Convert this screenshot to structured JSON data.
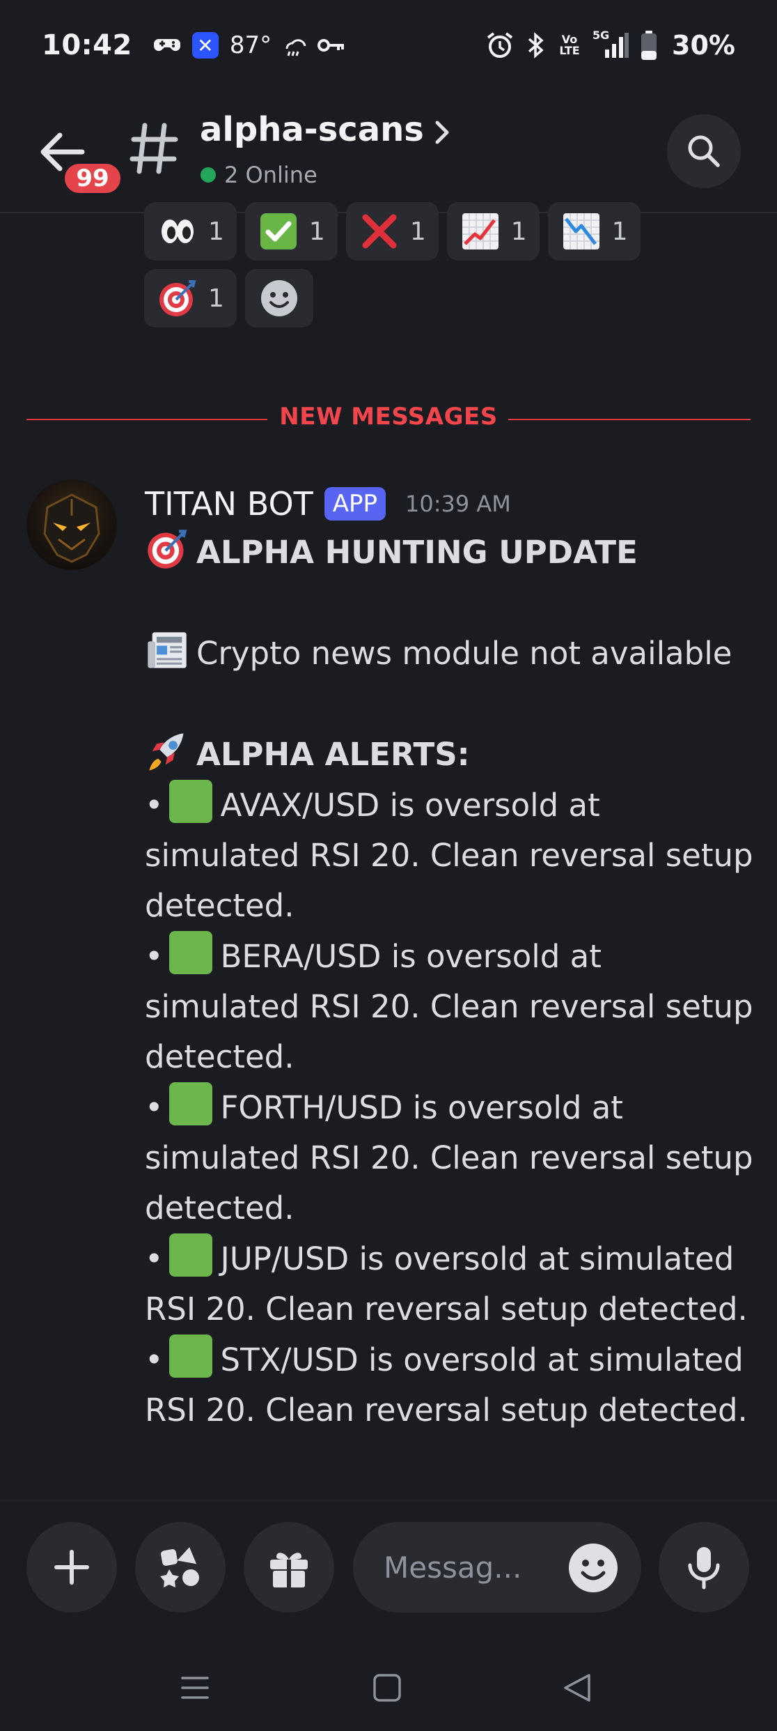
{
  "status_bar": {
    "time": "10:42",
    "temperature": "87°",
    "battery": "30%",
    "icons": [
      "gamepad-icon",
      "app-x-icon",
      "weather-icon",
      "key-icon",
      "alarm-icon",
      "bluetooth-icon",
      "volte-icon",
      "signal-5g-icon",
      "battery-icon"
    ],
    "volte_label": "Vo LTE",
    "network_label": "5G"
  },
  "header": {
    "unread_count": "99",
    "channel_name": "alpha-scans",
    "online_status": "2 Online"
  },
  "reactions": [
    {
      "emoji": "eyes-icon",
      "count": "1"
    },
    {
      "emoji": "check-mark-icon",
      "count": "1"
    },
    {
      "emoji": "cross-mark-icon",
      "count": "1"
    },
    {
      "emoji": "chart-increasing-icon",
      "count": "1"
    },
    {
      "emoji": "chart-decreasing-icon",
      "count": "1"
    },
    {
      "emoji": "direct-hit-icon",
      "count": "1"
    }
  ],
  "divider": {
    "label": "NEW MESSAGES"
  },
  "message": {
    "author": "TITAN BOT",
    "tag": "APP",
    "timestamp": "10:39 AM",
    "title": "ALPHA HUNTING UPDATE",
    "news_line": "Crypto news module not available",
    "alerts_heading": "ALPHA ALERTS:",
    "alerts": [
      {
        "l1": "AVAX/USD is oversold at",
        "l2": "simulated RSI 20. Clean reversal setup",
        "l3": "detected."
      },
      {
        "l1": "BERA/USD is oversold at",
        "l2": "simulated RSI 20. Clean reversal setup",
        "l3": "detected."
      },
      {
        "l1": "FORTH/USD is oversold at",
        "l2": "simulated RSI 20. Clean reversal setup",
        "l3": "detected."
      },
      {
        "l1": "JUP/USD is oversold at simulated",
        "l2": "RSI 20. Clean reversal setup detected."
      },
      {
        "l1": "STX/USD is oversold at simulated",
        "l2": "RSI 20. Clean reversal setup detected."
      }
    ],
    "bullet": "•"
  },
  "composer": {
    "placeholder": "Messag..."
  },
  "colors": {
    "background": "#1b1c21",
    "surface": "#2a2b31",
    "accent": "#5865f2",
    "danger": "#f2454c",
    "online": "#23a55a",
    "status_green": "#6cb64b"
  }
}
